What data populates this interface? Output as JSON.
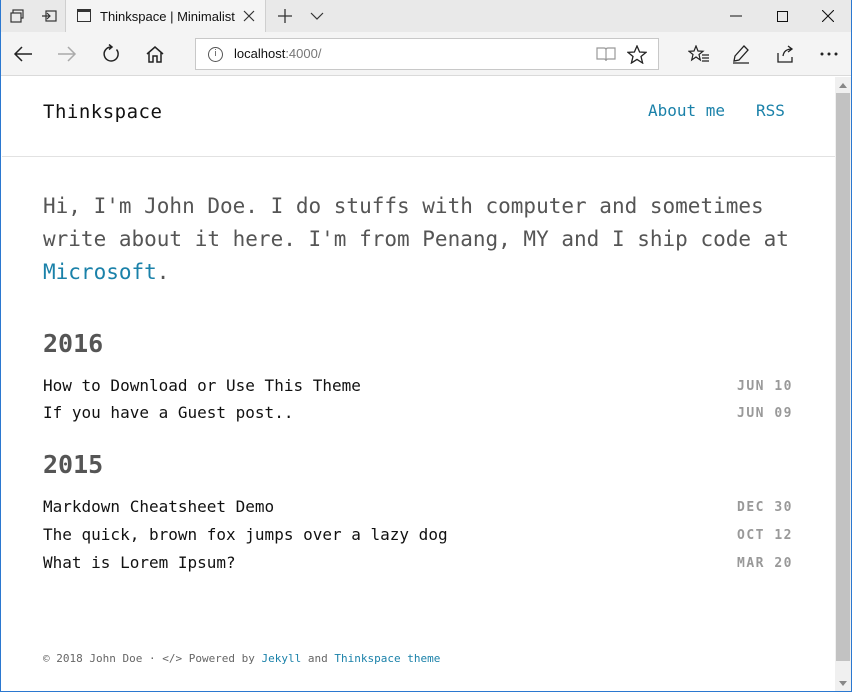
{
  "browser": {
    "tab_title": "Thinkspace | Minimalist",
    "address": {
      "host": "localhost",
      "port_path": ":4000/"
    }
  },
  "site": {
    "title": "Thinkspace",
    "nav": [
      {
        "label": "About me"
      },
      {
        "label": "RSS"
      }
    ],
    "intro": {
      "text_before": "Hi, I'm John Doe. I do stuffs with computer and sometimes write about it here. I'm from Penang, MY and I ship code at ",
      "link": "Microsoft",
      "text_after": "."
    },
    "years": [
      {
        "year": "2016",
        "posts": [
          {
            "title": "How to Download or Use This Theme",
            "date": "JUN 10"
          },
          {
            "title": "If you have a Guest post..",
            "date": "JUN 09"
          }
        ]
      },
      {
        "year": "2015",
        "posts": [
          {
            "title": "Markdown Cheatsheet Demo",
            "date": "DEC 30"
          },
          {
            "title": "The quick, brown fox jumps over a lazy dog",
            "date": "OCT 12"
          },
          {
            "title": "What is Lorem Ipsum?",
            "date": "MAR 20"
          }
        ]
      }
    ],
    "footer": {
      "prefix": "© 2018 John Doe · </> Powered by ",
      "jekyll": "Jekyll",
      "and": " and ",
      "theme": "Thinkspace theme"
    }
  },
  "colors": {
    "link": "#1a81a9",
    "text": "#555555",
    "date": "#999999"
  }
}
